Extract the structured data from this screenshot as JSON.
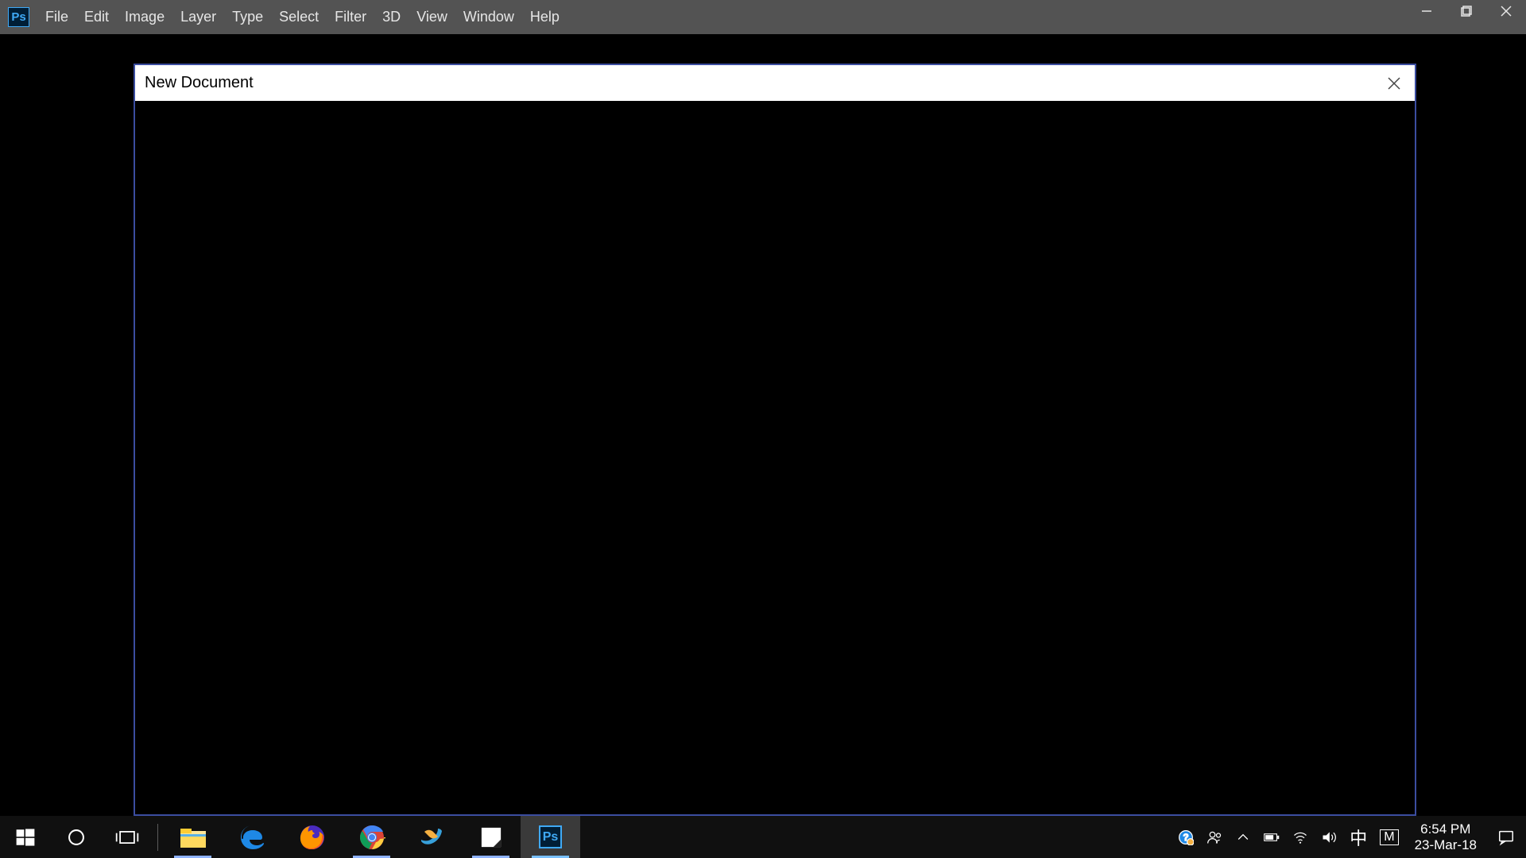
{
  "app": {
    "logo_text": "Ps",
    "menus": [
      "File",
      "Edit",
      "Image",
      "Layer",
      "Type",
      "Select",
      "Filter",
      "3D",
      "View",
      "Window",
      "Help"
    ]
  },
  "modal": {
    "title": "New Document"
  },
  "taskbar": {
    "ime": "中",
    "ime2": "M",
    "clock_time": "6:54 PM",
    "clock_date": "23-Mar-18",
    "ps_logo": "Ps"
  }
}
